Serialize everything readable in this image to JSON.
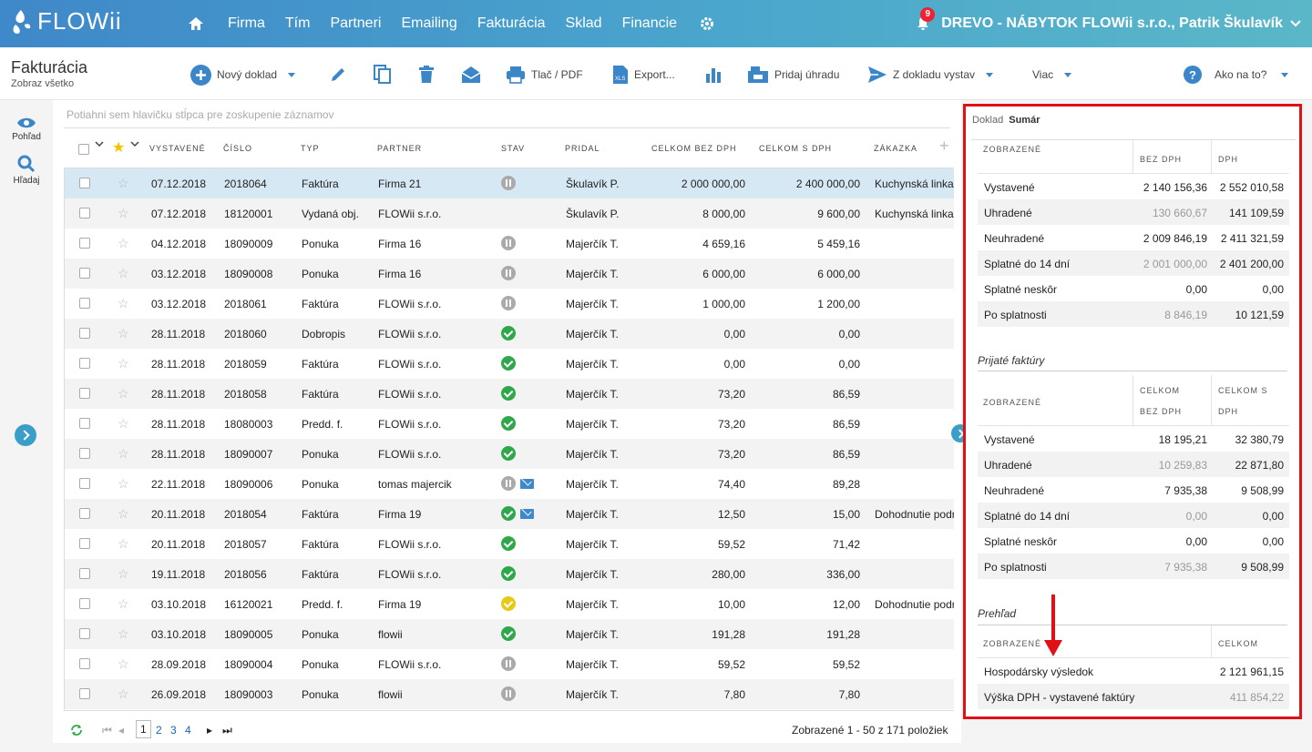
{
  "header": {
    "logo": "FLOWii",
    "nav": [
      "Firma",
      "Tím",
      "Partneri",
      "Emailing",
      "Fakturácia",
      "Sklad",
      "Financie"
    ],
    "notifications": "9",
    "company": "DREVO - NÁBYTOK FLOWii s.r.o., Patrik Škulavík"
  },
  "page": {
    "title": "Fakturácia",
    "subtitle": "Zobraz všetko"
  },
  "toolbar": {
    "new": "Nový doklad",
    "print": "Tlač / PDF",
    "export": "Export...",
    "add_payment": "Pridaj úhradu",
    "from_doc": "Z dokladu vystav",
    "more": "Viac",
    "help": "Ako na to?"
  },
  "rail": {
    "view": "Pohľad",
    "search": "Hľadaj"
  },
  "grid": {
    "group_hint": "Potiahni sem hlavičku stĺpca pre zoskupenie záznamov",
    "columns": [
      "VYSTAVENÉ",
      "ČÍSLO",
      "TYP",
      "PARTNER",
      "STAV",
      "PRIDAL",
      "CELKOM BEZ DPH",
      "CELKOM S DPH",
      "ZÁKAZKA"
    ],
    "rows": [
      {
        "date": "07.12.2018",
        "num": "2018064",
        "type": "Faktúra",
        "partner": "Firma 21",
        "status": "pause",
        "mail": "",
        "by": "Škulavík P.",
        "net": "2 000 000,00",
        "gross": "2 400 000,00",
        "order": "Kuchynská linka"
      },
      {
        "date": "07.12.2018",
        "num": "18120001",
        "type": "Vydaná obj.",
        "partner": "FLOWii s.r.o.",
        "status": "",
        "mail": "",
        "by": "Škulavík P.",
        "net": "8 000,00",
        "gross": "9 600,00",
        "order": "Kuchynská linka"
      },
      {
        "date": "04.12.2018",
        "num": "18090009",
        "type": "Ponuka",
        "partner": "Firma 16",
        "status": "pause",
        "mail": "",
        "by": "Majerčík T.",
        "net": "4 659,16",
        "gross": "5 459,16",
        "order": ""
      },
      {
        "date": "03.12.2018",
        "num": "18090008",
        "type": "Ponuka",
        "partner": "Firma 16",
        "status": "pause",
        "mail": "",
        "by": "Majerčík T.",
        "net": "6 000,00",
        "gross": "6 000,00",
        "order": ""
      },
      {
        "date": "03.12.2018",
        "num": "2018061",
        "type": "Faktúra",
        "partner": "FLOWii s.r.o.",
        "status": "pause",
        "mail": "",
        "by": "Majerčík T.",
        "net": "1 000,00",
        "gross": "1 200,00",
        "order": ""
      },
      {
        "date": "28.11.2018",
        "num": "2018060",
        "type": "Dobropis",
        "partner": "FLOWii s.r.o.",
        "status": "ok",
        "mail": "",
        "by": "Majerčík T.",
        "net": "0,00",
        "gross": "0,00",
        "order": ""
      },
      {
        "date": "28.11.2018",
        "num": "2018059",
        "type": "Faktúra",
        "partner": "FLOWii s.r.o.",
        "status": "ok",
        "mail": "",
        "by": "Majerčík T.",
        "net": "0,00",
        "gross": "0,00",
        "order": ""
      },
      {
        "date": "28.11.2018",
        "num": "2018058",
        "type": "Faktúra",
        "partner": "FLOWii s.r.o.",
        "status": "ok",
        "mail": "",
        "by": "Majerčík T.",
        "net": "73,20",
        "gross": "86,59",
        "order": ""
      },
      {
        "date": "28.11.2018",
        "num": "18080003",
        "type": "Predd. f.",
        "partner": "FLOWii s.r.o.",
        "status": "ok",
        "mail": "",
        "by": "Majerčík T.",
        "net": "73,20",
        "gross": "86,59",
        "order": ""
      },
      {
        "date": "28.11.2018",
        "num": "18090007",
        "type": "Ponuka",
        "partner": "FLOWii s.r.o.",
        "status": "ok",
        "mail": "",
        "by": "Majerčík T.",
        "net": "73,20",
        "gross": "86,59",
        "order": ""
      },
      {
        "date": "22.11.2018",
        "num": "18090006",
        "type": "Ponuka",
        "partner": "tomas majercik",
        "status": "pause",
        "mail": "mail",
        "by": "Majerčík T.",
        "net": "74,40",
        "gross": "89,28",
        "order": ""
      },
      {
        "date": "20.11.2018",
        "num": "2018054",
        "type": "Faktúra",
        "partner": "Firma 19",
        "status": "ok",
        "mail": "mail",
        "by": "Majerčík T.",
        "net": "12,50",
        "gross": "15,00",
        "order": "Dohodnutie podr"
      },
      {
        "date": "20.11.2018",
        "num": "2018057",
        "type": "Faktúra",
        "partner": "FLOWii s.r.o.",
        "status": "ok",
        "mail": "",
        "by": "Majerčík T.",
        "net": "59,52",
        "gross": "71,42",
        "order": ""
      },
      {
        "date": "19.11.2018",
        "num": "2018056",
        "type": "Faktúra",
        "partner": "FLOWii s.r.o.",
        "status": "ok",
        "mail": "",
        "by": "Majerčík T.",
        "net": "280,00",
        "gross": "336,00",
        "order": ""
      },
      {
        "date": "03.10.2018",
        "num": "16120021",
        "type": "Predd. f.",
        "partner": "Firma 19",
        "status": "warn",
        "mail": "",
        "by": "Majerčík T.",
        "net": "10,00",
        "gross": "12,00",
        "order": "Dohodnutie podr"
      },
      {
        "date": "03.10.2018",
        "num": "18090005",
        "type": "Ponuka",
        "partner": "flowii",
        "status": "ok",
        "mail": "",
        "by": "Majerčík T.",
        "net": "191,28",
        "gross": "191,28",
        "order": ""
      },
      {
        "date": "28.09.2018",
        "num": "18090004",
        "type": "Ponuka",
        "partner": "FLOWii s.r.o.",
        "status": "pause",
        "mail": "",
        "by": "Majerčík T.",
        "net": "59,52",
        "gross": "59,52",
        "order": ""
      },
      {
        "date": "26.09.2018",
        "num": "18090003",
        "type": "Ponuka",
        "partner": "flowii",
        "status": "pause",
        "mail": "",
        "by": "Majerčík T.",
        "net": "7,80",
        "gross": "7,80",
        "order": ""
      }
    ],
    "pages": [
      "1",
      "2",
      "3",
      "4"
    ],
    "summary": "Zobrazené 1 - 50 z 171 položiek"
  },
  "side": {
    "tab1": "Doklad",
    "tab2": "Sumár",
    "issued": {
      "headers": [
        "ZOBRAZENÉ",
        "BEZ DPH",
        "DPH"
      ],
      "rows": [
        {
          "label": "Vystavené",
          "a": "2 140 156,36",
          "b": "2 552 010,58"
        },
        {
          "label": "Uhradené",
          "a": "130 660,67",
          "b": "141 109,59"
        },
        {
          "label": "Neuhradené",
          "a": "2 009 846,19",
          "b": "2 411 321,59"
        },
        {
          "label": "Splatné do 14 dní",
          "a": "2 001 000,00",
          "b": "2 401 200,00"
        },
        {
          "label": "Splatné neskôr",
          "a": "0,00",
          "b": "0,00"
        },
        {
          "label": "Po splatnosti",
          "a": "8 846,19",
          "b": "10 121,59"
        }
      ]
    },
    "received_title": "Prijaté faktúry",
    "received": {
      "headers": [
        "ZOBRAZENÉ",
        "CELKOM",
        "BEZ DPH",
        "CELKOM S",
        "DPH"
      ],
      "rows": [
        {
          "label": "Vystavené",
          "a": "18 195,21",
          "b": "32 380,79"
        },
        {
          "label": "Uhradené",
          "a": "10 259,83",
          "b": "22 871,80"
        },
        {
          "label": "Neuhradené",
          "a": "7 935,38",
          "b": "9 508,99"
        },
        {
          "label": "Splatné do 14 dní",
          "a": "0,00",
          "b": "0,00"
        },
        {
          "label": "Splatné neskôr",
          "a": "0,00",
          "b": "0,00"
        },
        {
          "label": "Po splatnosti",
          "a": "7 935,38",
          "b": "9 508,99"
        }
      ]
    },
    "overview_title": "Prehľad",
    "overview": {
      "headers": [
        "ZOBRAZENÉ",
        "CELKOM"
      ],
      "rows": [
        {
          "label": "Hospodársky výsledok",
          "v": "2 121 961,15"
        },
        {
          "label": "Výška DPH - vystavené faktúry",
          "v": "411 854,22"
        }
      ]
    }
  },
  "colors": {
    "brand": "#3f88c9",
    "highlight": "#e01016"
  }
}
